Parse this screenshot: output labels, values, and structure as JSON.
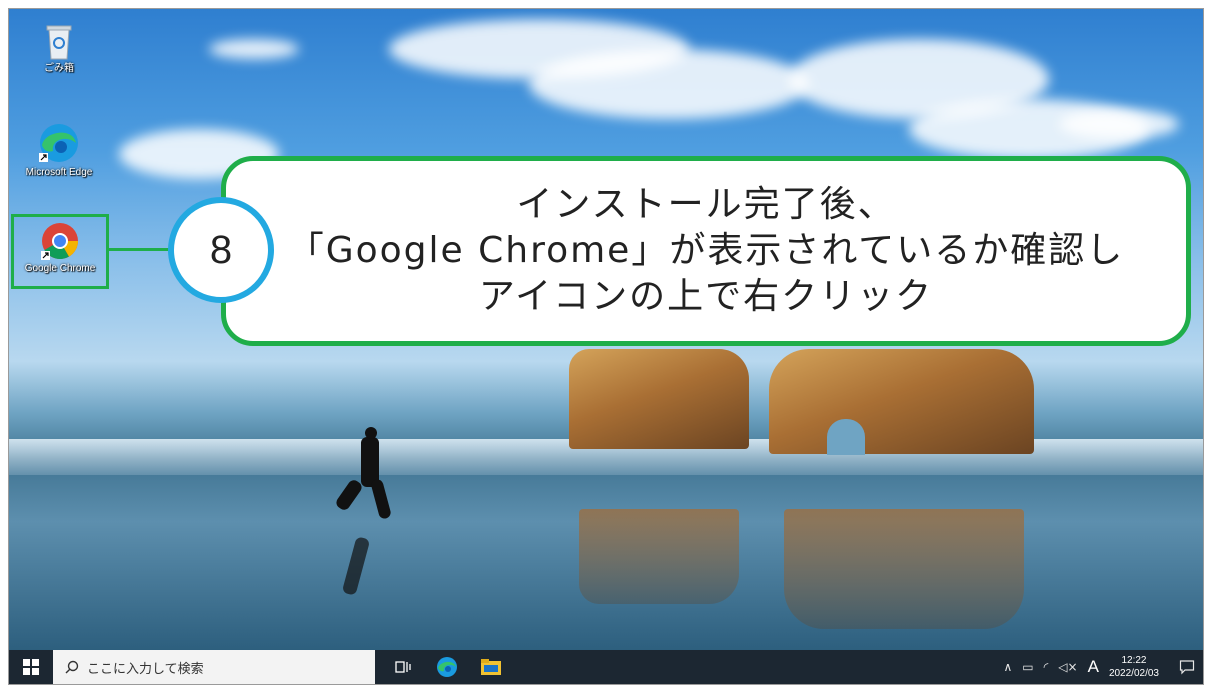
{
  "desktop": {
    "icons": [
      {
        "label": "ごみ箱",
        "icon": "recycle-bin-icon"
      },
      {
        "label": "Microsoft Edge",
        "icon": "edge-icon"
      },
      {
        "label": "Google Chrome",
        "icon": "chrome-icon"
      }
    ]
  },
  "instruction": {
    "step_number": "8",
    "lines": [
      "インストール完了後、",
      "「Google Chrome」が表示されているか確認し",
      "アイコンの上で右クリック"
    ],
    "border_color": "#1fae4a",
    "badge_color": "#23a9e1"
  },
  "taskbar": {
    "search_placeholder": "ここに入力して検索",
    "ime_indicator": "A",
    "time": "12:22",
    "date": "2022/02/03",
    "background": "#1c2732"
  }
}
